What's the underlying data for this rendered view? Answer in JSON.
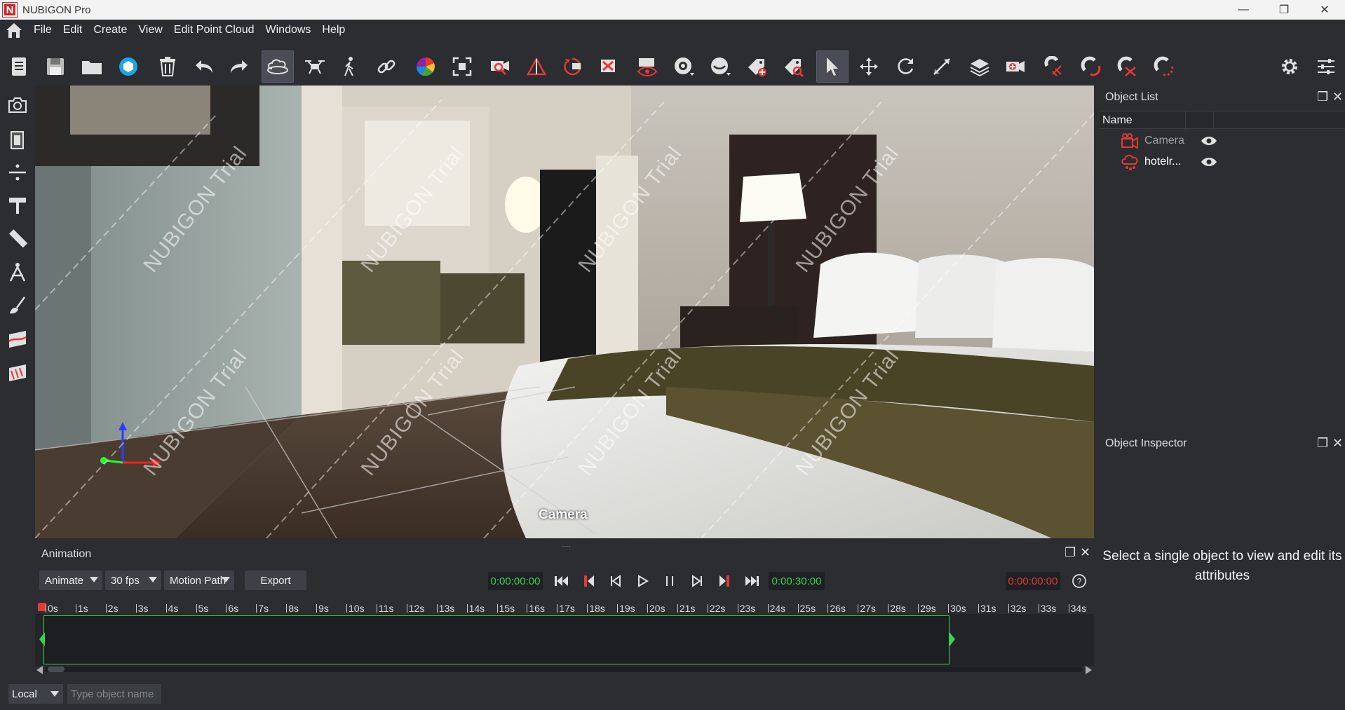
{
  "window": {
    "title": "NUBIGON Pro",
    "logo_letter": "N",
    "min_icon": "minimize-icon",
    "max_icon": "restore-icon",
    "close_icon": "close-icon"
  },
  "menu": {
    "home_icon": "home-icon",
    "items": [
      "File",
      "Edit",
      "Create",
      "View",
      "Edit Point Cloud",
      "Windows",
      "Help"
    ]
  },
  "toolbar": {
    "tools": [
      "new-document-icon",
      "save-icon",
      "open-folder-icon",
      "sketchfab-icon",
      "delete-icon",
      "undo-icon",
      "redo-icon",
      "orbit-icon",
      "drone-icon",
      "walk-icon",
      "link-icon",
      "color-palette-icon",
      "fit-view-icon",
      "camera-focus-icon",
      "perspective-icon",
      "camera-rotate-icon",
      "camera-delete-icon",
      "camera-view-icon",
      "eye-icon",
      "eye-closed-icon",
      "tag-add-icon",
      "tag-search-icon",
      "select-arrow-icon",
      "move-icon",
      "rotate-icon",
      "scale-icon",
      "layers-icon",
      "camera-add-icon",
      "magnet-grid-icon",
      "magnet-icon",
      "magnet-off-icon",
      "magnet-dashed-icon"
    ],
    "right_tools": [
      "settings-icon",
      "sliders-icon"
    ],
    "active": [
      "orbit-icon",
      "select-arrow-icon"
    ]
  },
  "left_tools": [
    "camera-icon",
    "clipbox-icon",
    "plane-icon",
    "signpost-icon",
    "ruler-icon",
    "compass-icon",
    "brush-icon",
    "section-icon",
    "slice-icon"
  ],
  "viewport": {
    "label": "Camera",
    "watermark": "NUBIGON Trial",
    "axis_icon": "axis-gizmo-icon"
  },
  "object_list": {
    "title": "Object List",
    "column_name": "Name",
    "objects": [
      {
        "icon": "camera-object-icon",
        "label": "Camera",
        "visible_icon": "eye-icon",
        "color": "#a0a0a0"
      },
      {
        "icon": "pointcloud-object-icon",
        "label": "hotelr...",
        "visible_icon": "eye-icon",
        "color": "#ffffff"
      }
    ]
  },
  "object_inspector": {
    "title": "Object Inspector",
    "message": "Select a single object to view and edit its attributes"
  },
  "animation": {
    "title": "Animation",
    "mode": "Animate",
    "fps": "30 fps",
    "path": "Motion Path",
    "export": "Export",
    "start_time": "0:00:00:00",
    "end_time": "0:00:30:00",
    "current_time": "0:00:00:00",
    "help_icon": "help-icon",
    "ruler_labels": [
      "0s",
      "1s",
      "2s",
      "3s",
      "4s",
      "5s",
      "6s",
      "7s",
      "8s",
      "9s",
      "10s",
      "11s",
      "12s",
      "13s",
      "14s",
      "15s",
      "16s",
      "17s",
      "18s",
      "19s",
      "20s",
      "21s",
      "22s",
      "23s",
      "24s",
      "25s",
      "26s",
      "27s",
      "28s",
      "29s",
      "30s",
      "31s",
      "32s",
      "33s",
      "34s"
    ]
  },
  "status": {
    "coord_mode": "Local",
    "object_search_placeholder": "Type object name"
  },
  "colors": {
    "accent_green": "#39d353",
    "accent_red": "#e53935",
    "brand_red": "#c62828"
  }
}
